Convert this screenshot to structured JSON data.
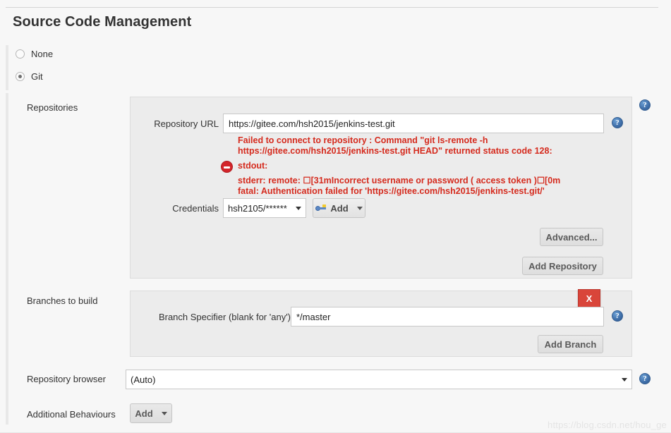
{
  "page": {
    "title": "Source Code Management",
    "watermark": "https://blog.csdn.net/hou_ge"
  },
  "scm_options": [
    {
      "label": "None",
      "selected": false
    },
    {
      "label": "Git",
      "selected": true
    }
  ],
  "repositories": {
    "section_label": "Repositories",
    "repository_url": {
      "label": "Repository URL",
      "value": "https://gitee.com/hsh2015/jenkins-test.git",
      "help": "?"
    },
    "error": {
      "line1": "Failed to connect to repository : Command \"git ls-remote -h",
      "line2": "https://gitee.com/hsh2015/jenkins-test.git HEAD\" returned status code 128:",
      "line3": "stdout:",
      "line4": "stderr: remote: ☐[31mIncorrect username or password ( access token )☐[0m",
      "line5": "fatal: Authentication failed for 'https://gitee.com/hsh2015/jenkins-test.git/'"
    },
    "credentials": {
      "label": "Credentials",
      "value": "hsh2105/******",
      "add_label": "Add"
    },
    "advanced_label": "Advanced...",
    "add_repository_label": "Add Repository"
  },
  "branches": {
    "section_label": "Branches to build",
    "delete_label": "X",
    "branch_specifier": {
      "label": "Branch Specifier (blank for 'any')",
      "value": "*/master",
      "help": "?"
    },
    "add_branch_label": "Add Branch"
  },
  "repository_browser": {
    "label": "Repository browser",
    "value": "(Auto)",
    "help": "?"
  },
  "additional_behaviours": {
    "label": "Additional Behaviours",
    "add_label": "Add"
  },
  "help_marks": {
    "repositories_section": "?"
  },
  "colors": {
    "error_red": "#d52b1e",
    "delete_red": "#d9453a",
    "help_blue": "#3f6ea8",
    "panel_bg": "#ececec",
    "page_bg": "#f7f7f7"
  }
}
